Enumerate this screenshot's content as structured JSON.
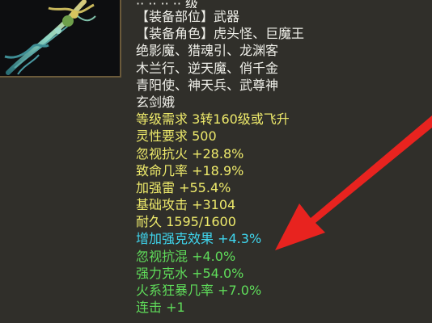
{
  "item": {
    "icon": "jade-weapon-icon",
    "header_partial": "·· ·· ·· ·· 级"
  },
  "lines": [
    {
      "text": "【装备部位】武器",
      "color": "white"
    },
    {
      "text": "【装备角色】虎头怪、巨魔王",
      "color": "white"
    },
    {
      "text": "绝影魔、猎魂引、龙渊客",
      "color": "white"
    },
    {
      "text": "木兰行、逆天魔、俏千金",
      "color": "white"
    },
    {
      "text": "青阳使、神天兵、武尊神",
      "color": "white"
    },
    {
      "text": "玄剑娥",
      "color": "white"
    },
    {
      "text": "等级需求 3转160级或飞升",
      "color": "yellow"
    },
    {
      "text": "灵性要求 500",
      "color": "yellow"
    },
    {
      "text": "忽视抗火 +28.8%",
      "color": "yellow"
    },
    {
      "text": "致命几率 +18.9%",
      "color": "yellow"
    },
    {
      "text": "加强雷 +55.4%",
      "color": "yellow"
    },
    {
      "text": "基础攻击 +3104",
      "color": "yellow"
    },
    {
      "text": "耐久 1595/1600",
      "color": "yellow"
    },
    {
      "text": "增加强克效果 +4.3%",
      "color": "cyan"
    },
    {
      "text": "忽视抗混 +4.0%",
      "color": "green"
    },
    {
      "text": "强力克水 +54.0%",
      "color": "green"
    },
    {
      "text": "火系狂暴几率 +7.0%",
      "color": "green"
    },
    {
      "text": "连击 +1",
      "color": "green"
    }
  ],
  "colors": {
    "white": "#f0f0ea",
    "yellow": "#eeea6b",
    "cyan": "#3fd6ee",
    "green": "#5fdc5a",
    "arrow": "#e8231f"
  }
}
